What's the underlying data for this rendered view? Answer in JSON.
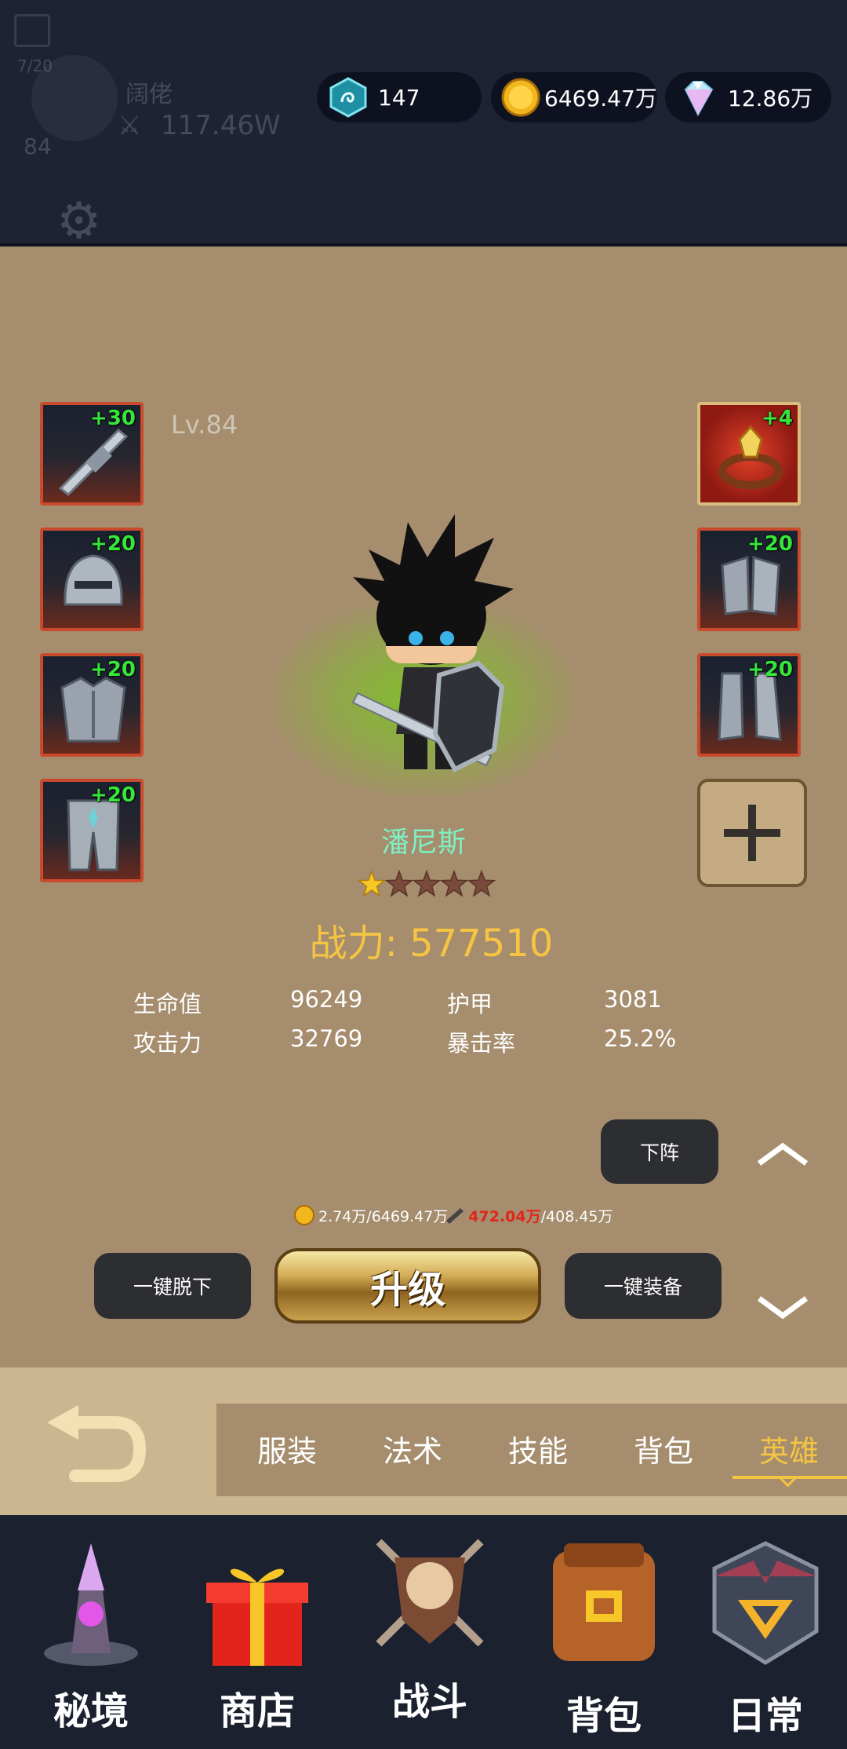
{
  "player": {
    "name": "阔佬",
    "power": "117.46W",
    "level": "84",
    "energy": "7/20"
  },
  "resources": [
    {
      "name": "rune-gem",
      "value": "147"
    },
    {
      "name": "gold",
      "value": "6469.47万"
    },
    {
      "name": "diamond",
      "value": "12.86万"
    }
  ],
  "hero": {
    "level_label": "Lv.84",
    "name": "潘尼斯",
    "stars_filled": 1,
    "stars_total": 5,
    "combat_power": "战力: 577510",
    "stats": [
      {
        "label": "生命值",
        "value": "96249"
      },
      {
        "label": "护甲",
        "value": "3081"
      },
      {
        "label": "攻击力",
        "value": "32769"
      },
      {
        "label": "暴击率",
        "value": "25.2%"
      }
    ]
  },
  "equipment": {
    "left": [
      {
        "name": "sword",
        "plus": "+30"
      },
      {
        "name": "helmet",
        "plus": "+20"
      },
      {
        "name": "chest-armor",
        "plus": "+20"
      },
      {
        "name": "leg-armor",
        "plus": "+20"
      }
    ],
    "right": [
      {
        "name": "ring",
        "plus": "+4"
      },
      {
        "name": "gauntlets",
        "plus": "+20"
      },
      {
        "name": "boots",
        "plus": "+20"
      }
    ]
  },
  "buttons": {
    "unequip_hero": "下阵",
    "unequip_all": "一键脱下",
    "upgrade": "升级",
    "equip_all": "一键装备"
  },
  "cost": {
    "gold": "2.74万/6469.47万",
    "material_have": "472.04万",
    "material_need": "/408.45万"
  },
  "tabs": [
    "服装",
    "法术",
    "技能",
    "背包",
    "英雄"
  ],
  "active_tab": "英雄",
  "nav": [
    "秘境",
    "商店",
    "战斗",
    "背包",
    "日常"
  ],
  "colors": {
    "panel": "#a58d6d",
    "hero_name": "#7ff0c4",
    "combat_power": "#f6c443",
    "active_tab": "#f6c443",
    "plus_text": "#37e63b",
    "cost_red": "#e0261b"
  }
}
